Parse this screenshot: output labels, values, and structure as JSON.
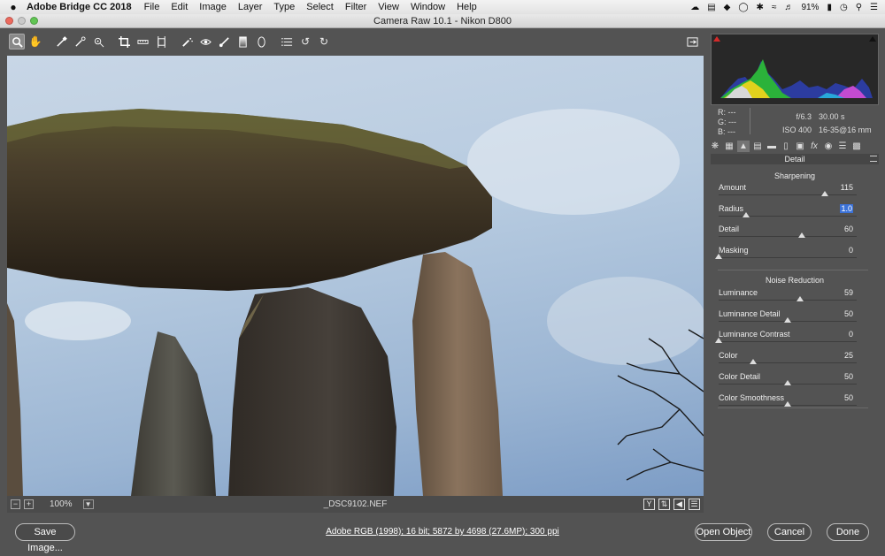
{
  "menubar": {
    "apple": "",
    "app_name": "Adobe Bridge CC 2018",
    "items": [
      "File",
      "Edit",
      "Image",
      "Layer",
      "Type",
      "Select",
      "Filter",
      "View",
      "Window",
      "Help"
    ],
    "battery": "91%"
  },
  "window": {
    "title": "Camera Raw 10.1  -  Nikon D800"
  },
  "toolbar": {
    "tools": [
      "zoom-tool",
      "hand-tool",
      "white-balance-tool",
      "color-sampler-tool",
      "targeted-adjustment-tool",
      "crop-tool",
      "straighten-tool",
      "transform-tool",
      "spot-removal-tool",
      "red-eye-tool",
      "adjustment-brush-tool",
      "graduated-filter-tool",
      "radial-filter-tool",
      "preferences-tool",
      "rotate-left-tool",
      "rotate-right-tool"
    ]
  },
  "readout": {
    "r_label": "R:",
    "r": "---",
    "g_label": "G:",
    "g": "---",
    "b_label": "B:",
    "b": "---",
    "aperture": "f/6.3",
    "shutter": "30.00 s",
    "iso": "ISO 400",
    "lens": "16-35@16 mm"
  },
  "panel": {
    "title": "Detail",
    "sharpening": {
      "title": "Sharpening",
      "sliders": [
        {
          "label": "Amount",
          "value": "115",
          "fraction": 0.77
        },
        {
          "label": "Radius",
          "value": "1.0",
          "fraction": 0.2
        },
        {
          "label": "Detail",
          "value": "60",
          "fraction": 0.6
        },
        {
          "label": "Masking",
          "value": "0",
          "fraction": 0.0
        }
      ]
    },
    "noise": {
      "title": "Noise Reduction",
      "sliders": [
        {
          "label": "Luminance",
          "value": "59",
          "fraction": 0.59
        },
        {
          "label": "Luminance Detail",
          "value": "50",
          "fraction": 0.5
        },
        {
          "label": "Luminance Contrast",
          "value": "0",
          "fraction": 0.0
        },
        {
          "label": "Color",
          "value": "25",
          "fraction": 0.25
        },
        {
          "label": "Color Detail",
          "value": "50",
          "fraction": 0.5
        },
        {
          "label": "Color Smoothness",
          "value": "50",
          "fraction": 0.5
        }
      ]
    }
  },
  "image_status": {
    "zoom": "100%",
    "filename": "_DSC9102.NEF"
  },
  "bottom": {
    "save_label": "Save Image...",
    "workflow": "Adobe RGB (1998); 16 bit; 5872 by 4698 (27.6MP); 300 ppi",
    "open_label": "Open Object",
    "cancel_label": "Cancel",
    "done_label": "Done"
  },
  "colors": {
    "panel_bg": "#535353",
    "selection": "#3b72d8",
    "clip_shadow": "#d42a2a"
  }
}
